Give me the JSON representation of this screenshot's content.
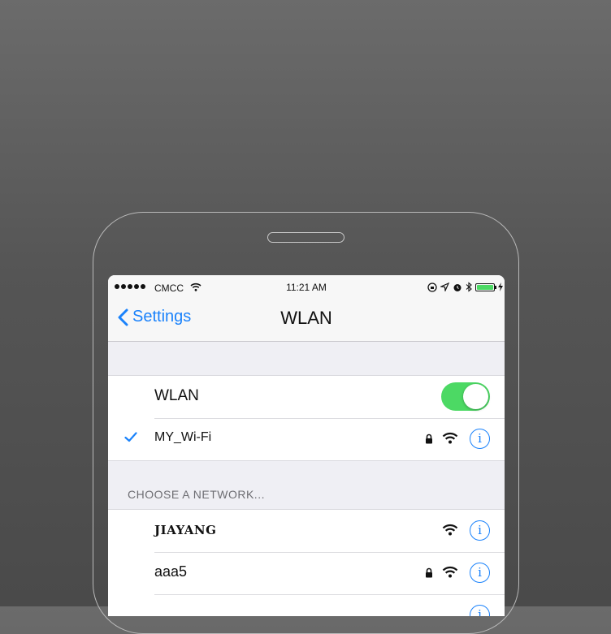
{
  "status_bar": {
    "carrier": "CMCC",
    "time": "11:21 AM",
    "icons": [
      "signal-dots",
      "wifi-icon",
      "lock-rotation-icon",
      "location-icon",
      "alarm-icon",
      "bluetooth-icon",
      "battery-icon",
      "charging-icon"
    ],
    "battery_level": 1.0,
    "battery_color": "#4cd964"
  },
  "navbar": {
    "back_label": "Settings",
    "title": "WLAN"
  },
  "wlan_group": {
    "toggle_label": "WLAN",
    "toggle_on": true,
    "connected_network": "MY_Wi-Fi"
  },
  "section_header": "CHOOSE A NETWORK...",
  "networks": [
    {
      "name": "JIAYANG",
      "locked": false
    },
    {
      "name": "aaa5",
      "locked": true
    }
  ],
  "colors": {
    "accent": "#1a82fb",
    "toggle_on": "#4cd964"
  }
}
